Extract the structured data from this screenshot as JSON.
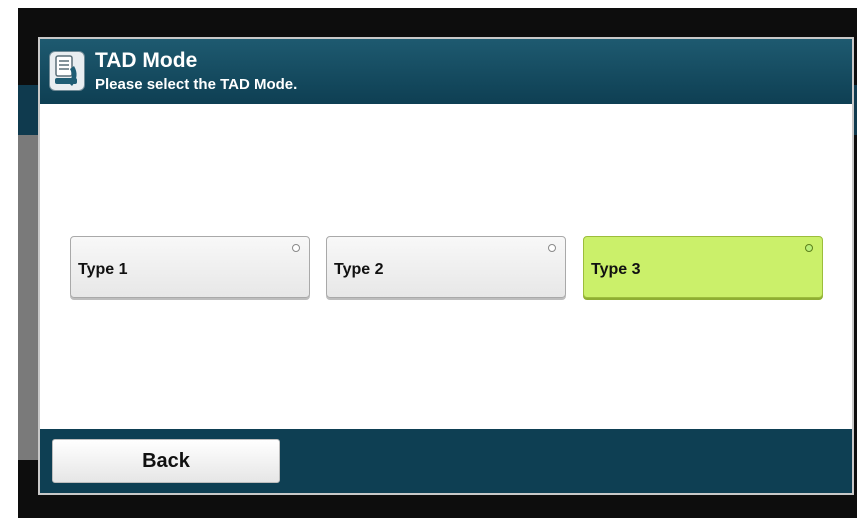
{
  "dialog": {
    "title": "TAD Mode",
    "subtitle": "Please select the TAD Mode.",
    "icon": "fax-handset-icon"
  },
  "options": [
    {
      "label": "Type 1",
      "selected": false
    },
    {
      "label": "Type 2",
      "selected": false
    },
    {
      "label": "Type 3",
      "selected": true
    }
  ],
  "footer": {
    "back_label": "Back"
  },
  "colors": {
    "titlebar": "#0e3f53",
    "selected_option": "#cbf06a",
    "option": "#eeeeee"
  }
}
